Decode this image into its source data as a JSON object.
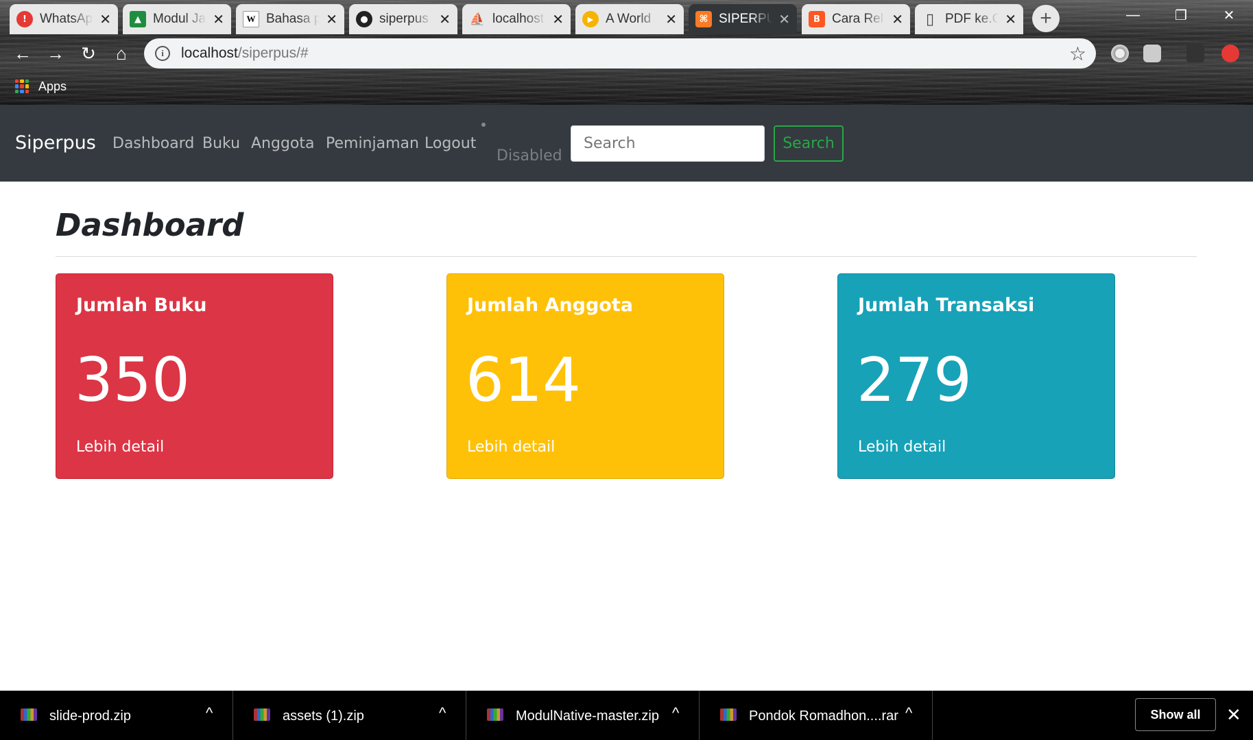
{
  "browser": {
    "tabs": [
      {
        "title": "WhatsApp",
        "icon": "whatsapp-icon",
        "color": "#e53935",
        "glyph": "!"
      },
      {
        "title": "Modul Java",
        "icon": "classroom-icon",
        "color": "#1e8e3e",
        "glyph": "▲"
      },
      {
        "title": "Bahasa pemrograman",
        "icon": "wikipedia-icon",
        "color": "#ffffff",
        "glyph": "W"
      },
      {
        "title": "siperpus",
        "icon": "github-icon",
        "color": "#222222",
        "glyph": "●"
      },
      {
        "title": "localhost",
        "icon": "phpmyadmin-icon",
        "color": "#f39c12",
        "glyph": "⛵"
      },
      {
        "title": "A World",
        "icon": "play-icon",
        "color": "#f6b400",
        "glyph": "▶"
      },
      {
        "title": "SIPERPUS",
        "icon": "xampp-icon",
        "color": "#fb7a24",
        "glyph": "⌘"
      },
      {
        "title": "Cara Rel",
        "icon": "blogger-icon",
        "color": "#ff5722",
        "glyph": "B"
      },
      {
        "title": "PDF ke.C",
        "icon": "document-icon",
        "color": "#e8e8e8",
        "glyph": "▯"
      }
    ],
    "active_tab": 6,
    "url_host": "localhost",
    "url_path": "/siperpus/#",
    "bookmark_apps": "Apps"
  },
  "navbar": {
    "brand": "Siperpus",
    "links": [
      "Dashboard",
      "Buku",
      "Anggota",
      "Peminjaman",
      "Logout"
    ],
    "disabled": "Disabled",
    "search_placeholder": "Search",
    "search_button": "Search"
  },
  "main": {
    "title": "Dashboard",
    "cards": [
      {
        "title": "Jumlah Buku",
        "value": "350",
        "link": "Lebih detail",
        "color": "#dc3545"
      },
      {
        "title": "Jumlah Anggota",
        "value": "614",
        "link": "Lebih detail",
        "color": "#ffc107"
      },
      {
        "title": "Jumlah Transaksi",
        "value": "279",
        "link": "Lebih detail",
        "color": "#17a2b8"
      }
    ]
  },
  "downloads": {
    "items": [
      "slide-prod.zip",
      "assets (1).zip",
      "ModulNative-master.zip",
      "Pondok Romadhon....rar"
    ],
    "show_all": "Show all"
  }
}
